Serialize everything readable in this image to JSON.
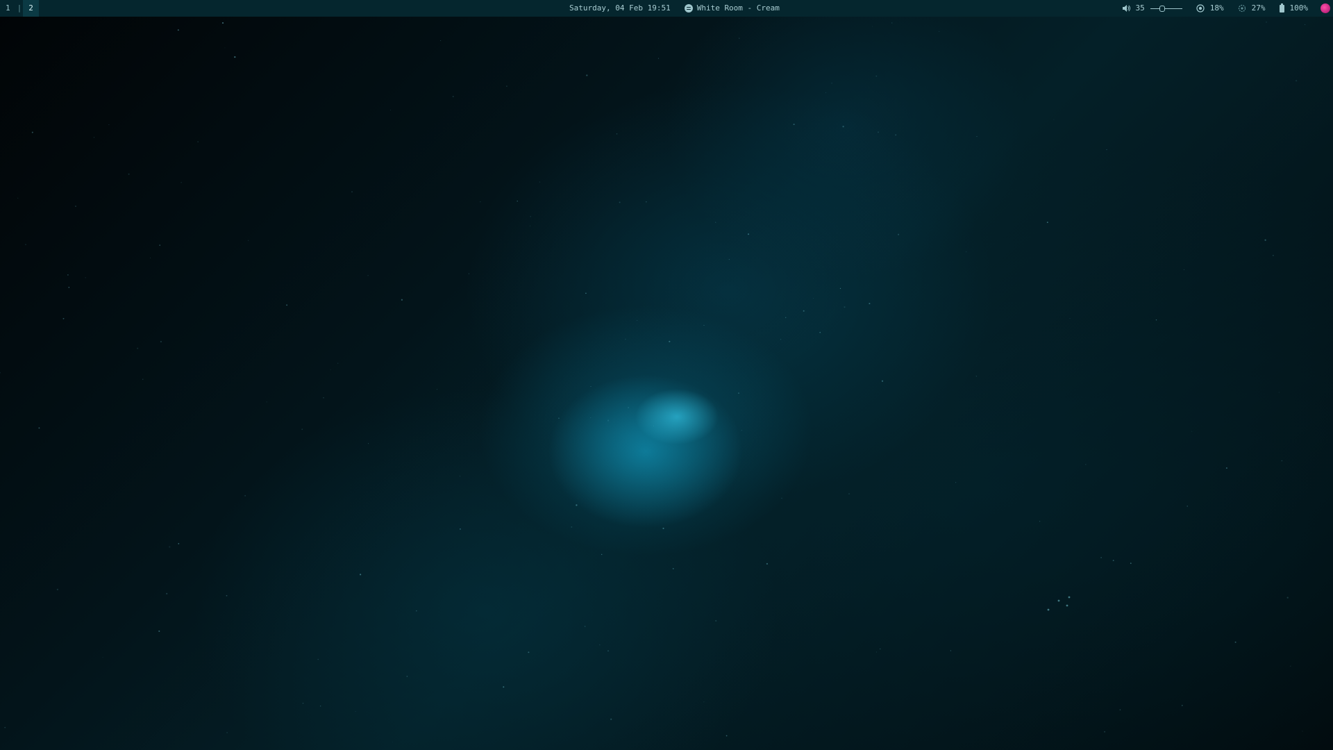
{
  "workspaces": [
    {
      "label": "1",
      "active": false
    },
    {
      "label": "2",
      "active": true
    }
  ],
  "workspace_separator": "|",
  "clock": "Saturday, 04 Feb 19:51",
  "now_playing": {
    "icon": "spotify-icon",
    "track": "White Room - Cream"
  },
  "volume": {
    "icon": "speaker-icon",
    "value": "35",
    "level": 0.35
  },
  "cpu": {
    "icon": "cpu-icon",
    "value": "18%"
  },
  "memory": {
    "icon": "memory-icon",
    "value": "27%"
  },
  "battery": {
    "icon": "battery-icon",
    "value": "100%"
  },
  "user": {
    "icon": "avatar-icon"
  },
  "colors": {
    "bar_background": "#05262e",
    "bar_text": "#9fc6cc",
    "accent": "#ff4fa8",
    "wallpaper_glow": "#3cdcff"
  },
  "wallpaper": "nebula-wallpaper"
}
